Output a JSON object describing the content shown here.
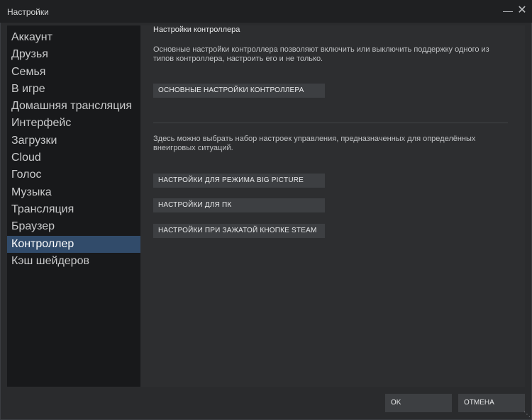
{
  "window": {
    "title": "Настройки",
    "minimize_icon": "minimize-icon",
    "close_icon": "close-icon"
  },
  "sidebar": {
    "items": [
      {
        "label": "Аккаунт"
      },
      {
        "label": "Друзья"
      },
      {
        "label": "Семья"
      },
      {
        "label": "В игре"
      },
      {
        "label": "Домашняя трансляция"
      },
      {
        "label": "Интерфейс"
      },
      {
        "label": "Загрузки"
      },
      {
        "label": "Cloud"
      },
      {
        "label": "Голос"
      },
      {
        "label": "Музыка"
      },
      {
        "label": "Трансляция"
      },
      {
        "label": "Браузер"
      },
      {
        "label": "Контроллер"
      },
      {
        "label": "Кэш шейдеров"
      }
    ],
    "active_index": 12
  },
  "main": {
    "title": "Настройки контроллера",
    "description_1": "Основные настройки контроллера позволяют включить или выключить поддержку одного из типов контроллера, настроить его и не только.",
    "button_general": "ОСНОВНЫЕ НАСТРОЙКИ КОНТРОЛЛЕРА",
    "description_2": "Здесь можно выбрать набор настроек управления, предназначенных для определённых внеигровых ситуаций.",
    "button_big_picture": "НАСТРОЙКИ ДЛЯ РЕЖИМА BIG PICTURE",
    "button_pc": "НАСТРОЙКИ ДЛЯ ПК",
    "button_guide": "НАСТРОЙКИ ПРИ ЗАЖАТОЙ КНОПКЕ STEAM"
  },
  "footer": {
    "ok_label": "OK",
    "cancel_label": "ОТМЕНА"
  },
  "colors": {
    "window_bg": "#2a2b2d",
    "sidebar_bg": "#18191b",
    "active_item": "#314b6a",
    "button_bg": "#3d3f42"
  }
}
